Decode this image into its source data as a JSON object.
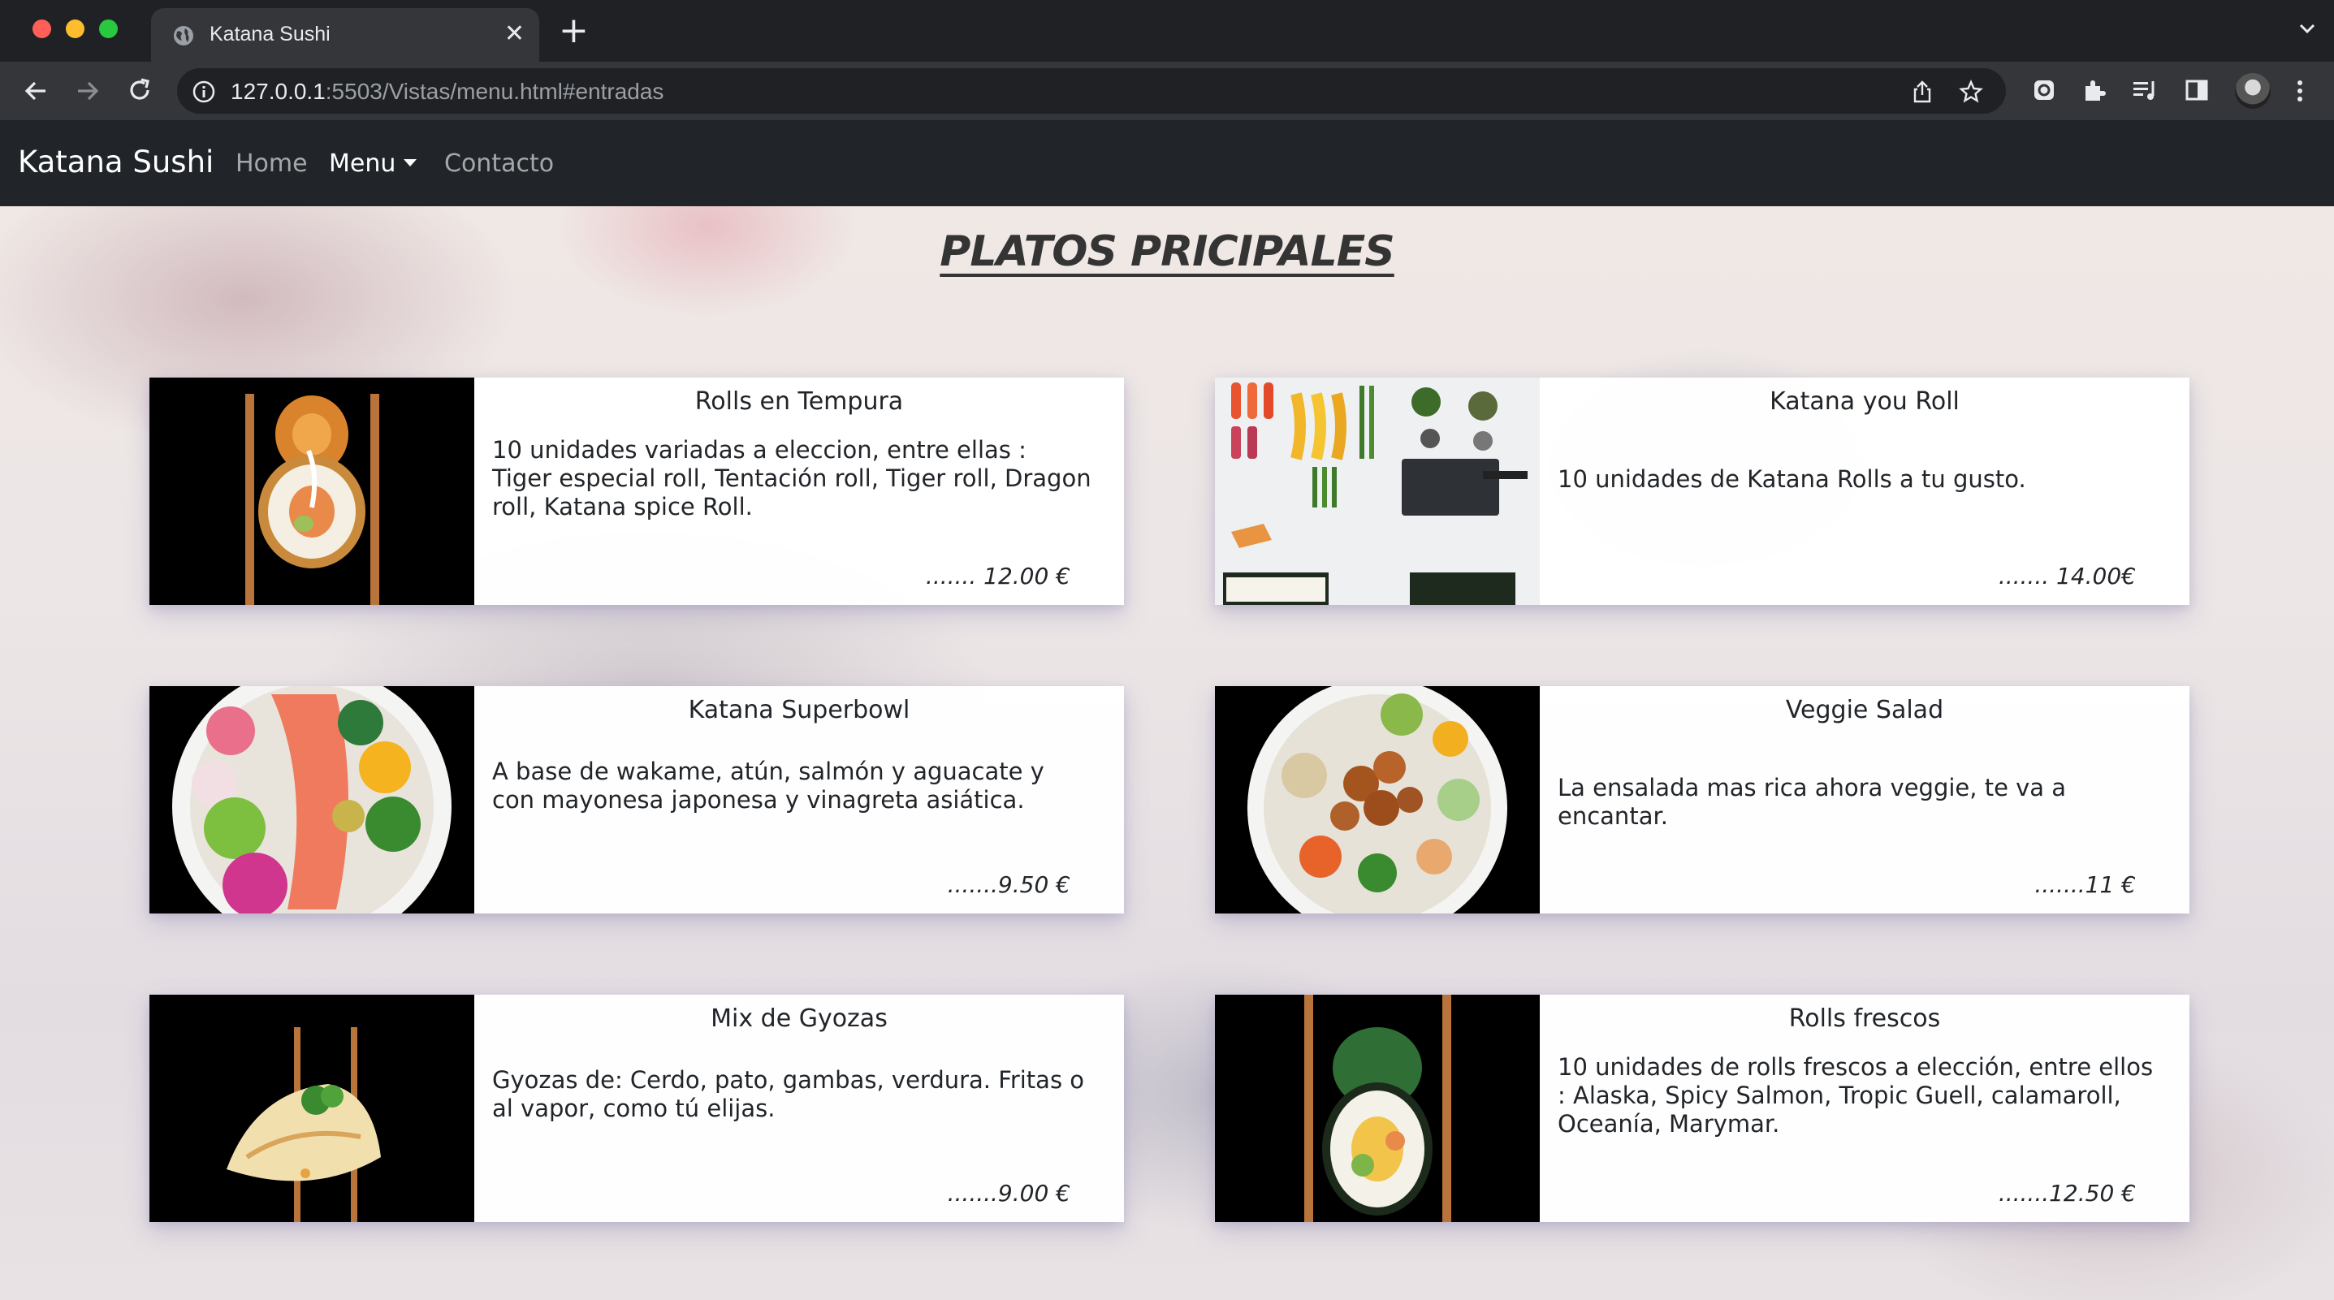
{
  "browser": {
    "tab_title": "Katana Sushi",
    "url_host": "127.0.0.1",
    "url_rest": ":5503/Vistas/menu.html#entradas"
  },
  "navbar": {
    "brand": "Katana Sushi",
    "links": {
      "home": "Home",
      "menu": "Menu",
      "contacto": "Contacto"
    }
  },
  "heading": "PLATOS PRICIPALES",
  "dishes": [
    {
      "title": "Rolls en Tempura",
      "desc": "10 unidades variadas a eleccion, entre ellas : Tiger especial roll, Tentación roll, Tiger roll, Dragon roll, Katana spice Roll.",
      "price": "....... 12.00 €"
    },
    {
      "title": "Katana you Roll",
      "desc": "10 unidades de Katana Rolls a tu gusto.",
      "price": "....... 14.00€"
    },
    {
      "title": "Katana Superbowl",
      "desc": "A base de wakame, atún, salmón y aguacate y con mayonesa japonesa y vinagreta asiática.",
      "price": ".......9.50 €"
    },
    {
      "title": "Veggie Salad",
      "desc": "La ensalada mas rica ahora veggie, te va a encantar.",
      "price": ".......11 €"
    },
    {
      "title": "Mix de Gyozas",
      "desc": "Gyozas de: Cerdo, pato, gambas, verdura. Fritas o al vapor, como tú elijas.",
      "price": ".......9.00 €"
    },
    {
      "title": "Rolls frescos",
      "desc": "10 unidades de rolls frescos a elección, entre ellos : Alaska, Spicy Salmon, Tropic Guell, calamaroll, Oceanía, Marymar.",
      "price": ".......12.50 €"
    }
  ],
  "colors": {
    "navbar": "#212529",
    "card": "#ffffff",
    "chrome": "#202124"
  }
}
